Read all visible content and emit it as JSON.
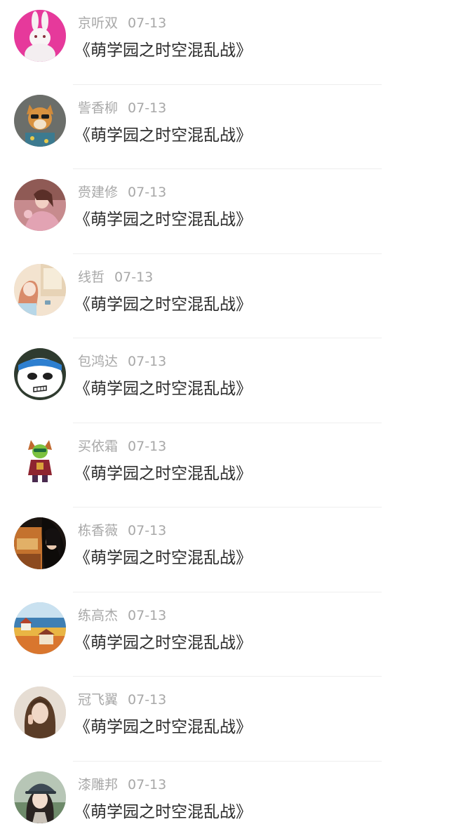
{
  "items": [
    {
      "name": "京听双",
      "date": "07-13",
      "title": "《萌学园之时空混乱战》",
      "avatar": "rabbit-avatar"
    },
    {
      "name": "訾香柳",
      "date": "07-13",
      "title": "《萌学园之时空混乱战》",
      "avatar": "shiba-dog-avatar"
    },
    {
      "name": "赍建修",
      "date": "07-13",
      "title": "《萌学园之时空混乱战》",
      "avatar": "portrait-pink-avatar"
    },
    {
      "name": "线哲",
      "date": "07-13",
      "title": "《萌学园之时空混乱战》",
      "avatar": "illustrated-girl-avatar"
    },
    {
      "name": "包鸿达",
      "date": "07-13",
      "title": "《萌学园之时空混乱战》",
      "avatar": "panda-avatar"
    },
    {
      "name": "买依霜",
      "date": "07-13",
      "title": "《萌学园之时空混乱战》",
      "avatar": "game-character-avatar"
    },
    {
      "name": "栋香薇",
      "date": "07-13",
      "title": "《萌学园之时空混乱战》",
      "avatar": "woman-portrait-avatar"
    },
    {
      "name": "练高杰",
      "date": "07-13",
      "title": "《萌学园之时空混乱战》",
      "avatar": "landscape-avatar"
    },
    {
      "name": "冠飞翼",
      "date": "07-13",
      "title": "《萌学园之时空混乱战》",
      "avatar": "woman-long-hair-avatar"
    },
    {
      "name": "漆雕邦",
      "date": "07-13",
      "title": "《萌学园之时空混乱战》",
      "avatar": "woman-cap-avatar"
    }
  ],
  "colors": {
    "name_text": "#a8a8a8",
    "title_text": "#2b2b2b",
    "divider": "#eeeeee",
    "background": "#ffffff"
  }
}
